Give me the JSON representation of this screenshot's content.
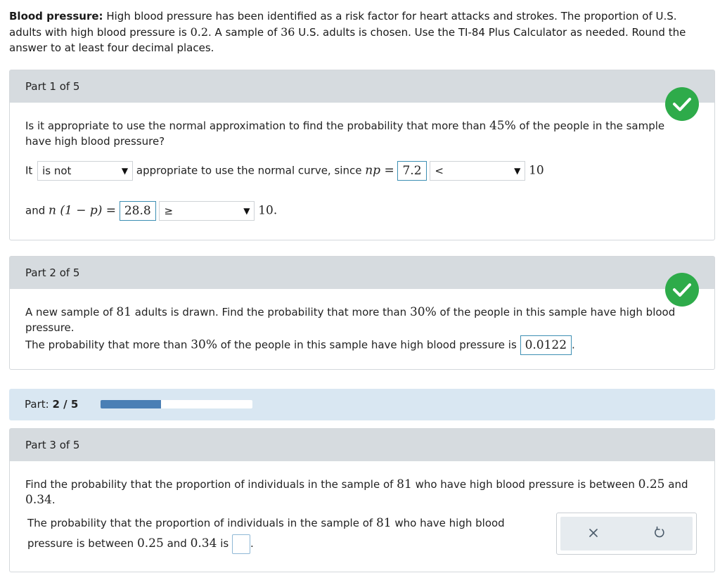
{
  "intro": {
    "bold_label": "Blood pressure:",
    "text1": " High blood pressure has been identified as a risk factor for heart attacks and strokes. The proportion of U.S. adults with high blood pressure is ",
    "p": "0.2",
    "text2": ". A sample of ",
    "n": "36",
    "text3": " U.S. adults is chosen. Use the TI-84 Plus Calculator as needed. Round the answer to at least four decimal places."
  },
  "part1": {
    "header": "Part 1 of 5",
    "q1": "Is it appropriate to use the normal approximation to find the probability that more than ",
    "q_pct": "45%",
    "q2": " of the people in the sample have high blood pressure?",
    "it": "It",
    "select1": "is not",
    "mid": "appropriate to use the normal curve, since",
    "np_label": "np =",
    "np_value": "7.2",
    "select2": "<",
    "ten1": "10",
    "and": "and",
    "n1p_label": "n (1 − p) =",
    "n1p_value": "28.8",
    "select3": "≥",
    "ten2": "10."
  },
  "part2": {
    "header": "Part 2 of 5",
    "q1": "A new sample of ",
    "n": "81",
    "q2": " adults is drawn. Find the probability that more than ",
    "pct": "30%",
    "q3": " of the people in this sample have high blood pressure.",
    "a1": "The probability that more than ",
    "a_pct": "30%",
    "a2": " of the people in this sample have high blood pressure is",
    "answer": "0.0122",
    "period": "."
  },
  "progress": {
    "label_prefix": "Part:",
    "label_value": "2 / 5",
    "fraction": 0.4
  },
  "part3": {
    "header": "Part 3 of 5",
    "q1": "Find the probability that the proportion of individuals in the sample of ",
    "n": "81",
    "q2": " who have high blood pressure is between ",
    "low": "0.25",
    "q3": " and ",
    "high": "0.34",
    "q4": ".",
    "a1": "The probability that the proportion of individuals in the sample of ",
    "a_n": "81",
    "a2": " who have high blood pressure is between ",
    "a_low": "0.25",
    "a3": " and ",
    "a_high": "0.34",
    "a4": " is",
    "period": "."
  },
  "tools": {
    "clear_icon": "x-icon",
    "undo_icon": "undo-icon"
  },
  "colors": {
    "check": "#2eab4a",
    "progress_fill": "#4a7fb5",
    "header_bg": "#d6dbdf"
  }
}
